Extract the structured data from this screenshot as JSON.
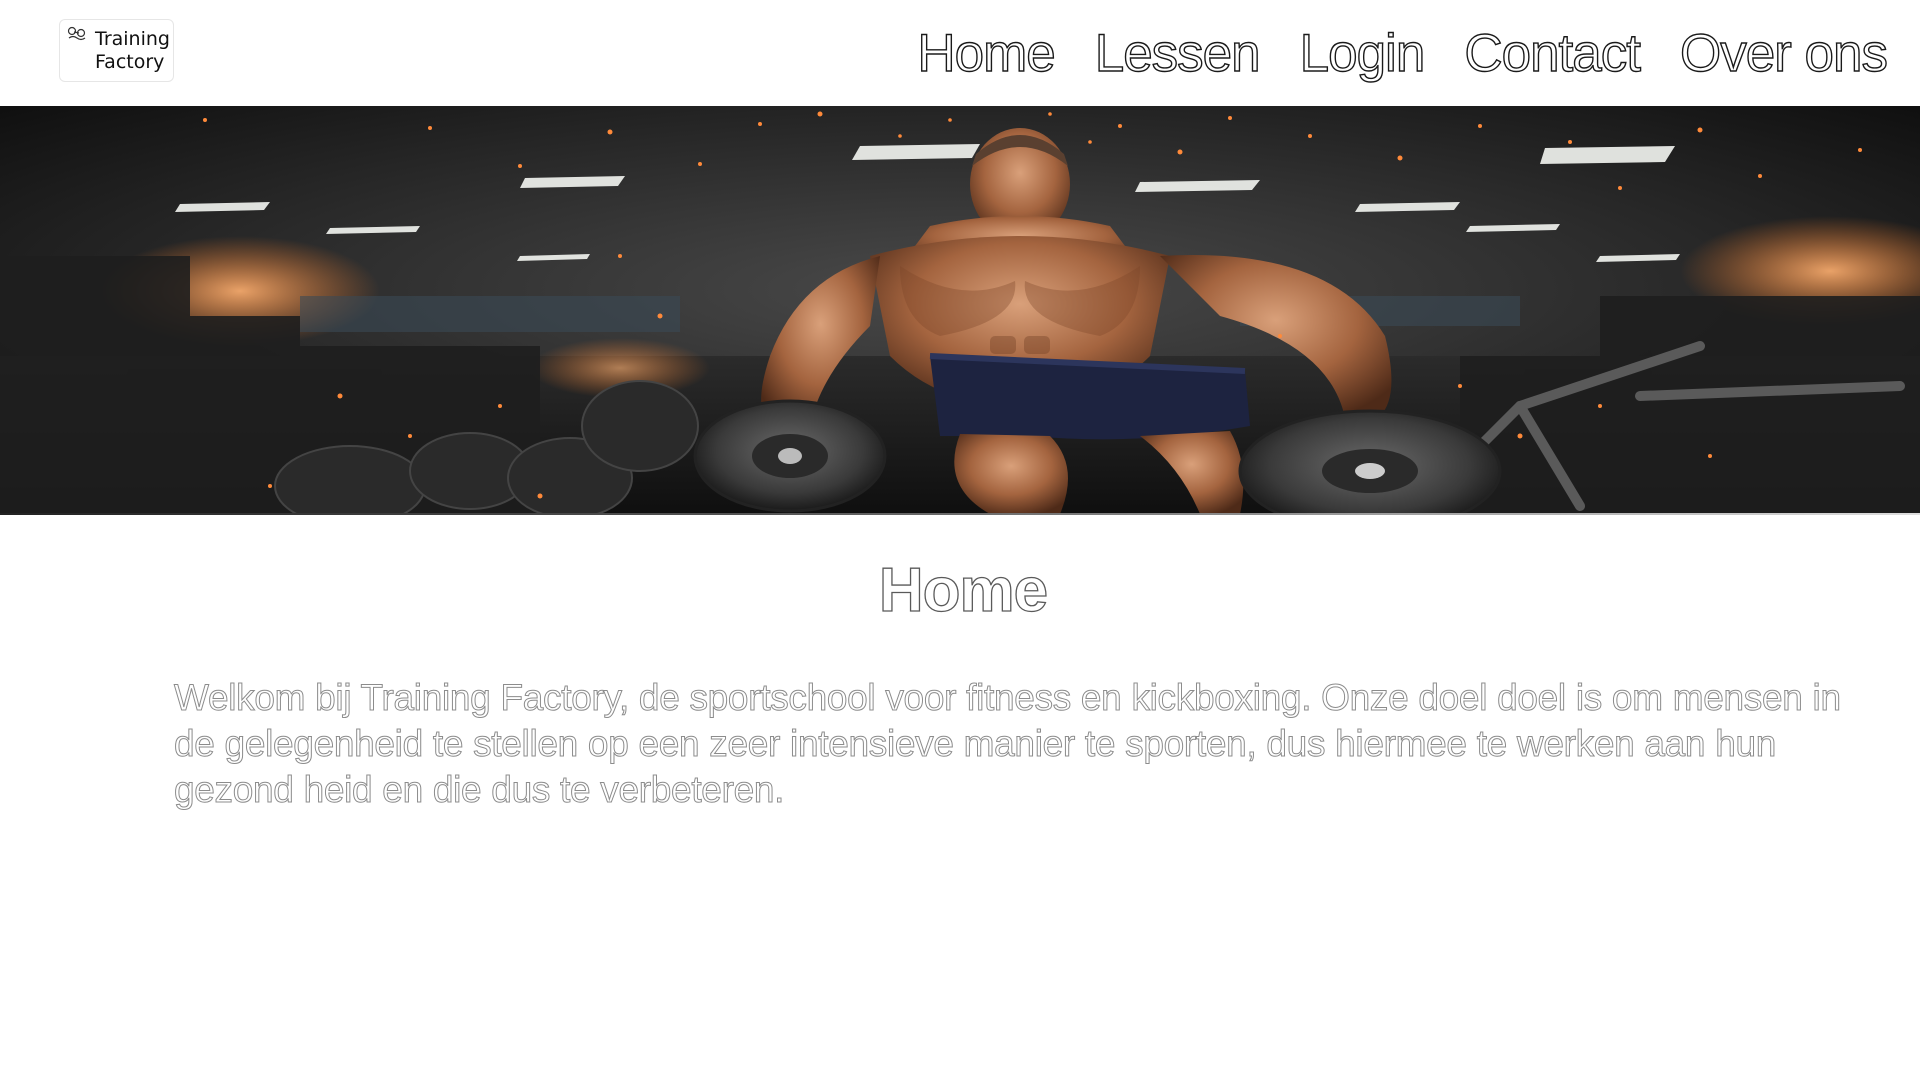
{
  "logo": {
    "line1": "Training",
    "line2": "Factory",
    "icon": "dumbbell-icon"
  },
  "nav": {
    "items": [
      {
        "label": "Home"
      },
      {
        "label": "Lessen"
      },
      {
        "label": "Login"
      },
      {
        "label": "Contact"
      },
      {
        "label": "Over ons"
      }
    ]
  },
  "hero": {
    "image": "bodybuilder-in-gym-with-weight-plates"
  },
  "main": {
    "title": "Home",
    "intro": "Welkom bij Training Factory, de sportschool voor fitness en kickboxing. Onze doel doel is om mensen in de gelegenheid te stellen op een zeer intensieve manier te sporten, dus hiermee te werken aan hun gezond heid en die dus te verbeteren."
  },
  "colors": {
    "text_dark": "#1a1a1a",
    "text_muted": "#8c8c8c",
    "background": "#ffffff"
  }
}
